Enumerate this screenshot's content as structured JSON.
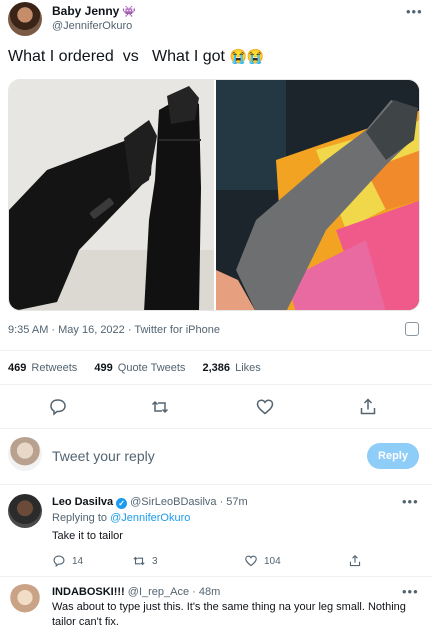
{
  "tweet": {
    "author_name": "Baby Jenny",
    "name_emoji": "👾",
    "author_handle": "@JenniferOkuro",
    "text": "What I ordered  vs   What I got",
    "text_emoji": "😭😭",
    "timestamp": "9:35 AM · May 16, 2022 · Twitter for iPhone",
    "stats": {
      "retweets_count": "469",
      "retweets_label": "Retweets",
      "quote_count": "499",
      "quote_label": "Quote Tweets",
      "likes_count": "2,386",
      "likes_label": "Likes"
    }
  },
  "reply_composer": {
    "placeholder": "Tweet your reply",
    "button_label": "Reply"
  },
  "replies": [
    {
      "name": "Leo Dasilva",
      "handle_time": "@SirLeoBDasilva · 57m",
      "replying_prefix": "Replying to",
      "replying_to": "@JenniferOkuro",
      "text": "Take it to tailor",
      "reply_count": "14",
      "retweet_count": "3",
      "like_count": "104"
    },
    {
      "name": "INDABOSKI!!!",
      "handle_time": "@I_rep_Ace · 48m",
      "text": "Was about to type just this. It's the same thing na your leg small. Nothing tailor can't fix."
    }
  ],
  "colors": {
    "accent": "#1d9bf0",
    "reply_button": "#8ecdf8",
    "muted_text": "#536471"
  },
  "icons": {
    "reply": "reply-icon",
    "retweet": "retweet-icon",
    "like": "heart-icon",
    "share": "share-icon",
    "more": "more-icon",
    "verified": "verified-badge-icon",
    "analytics": "analytics-icon"
  }
}
